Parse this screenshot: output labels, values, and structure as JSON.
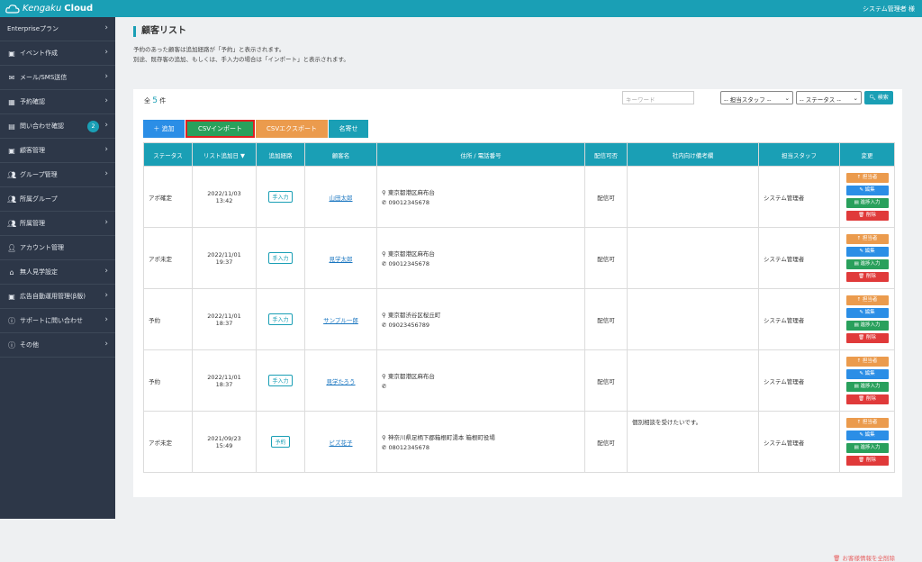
{
  "header": {
    "logo_prefix": "Kengaku",
    "logo_suffix": "Cloud",
    "user": "システム管理者 様"
  },
  "sidebar": {
    "items": [
      {
        "label": "Enterpriseプラン",
        "icon": "none",
        "chevron": true
      },
      {
        "label": "イベント作成",
        "icon": "image-icon",
        "chevron": true
      },
      {
        "label": "メール/SMS送信",
        "icon": "mail-icon",
        "chevron": true
      },
      {
        "label": "予約確認",
        "icon": "calendar-icon",
        "chevron": true
      },
      {
        "label": "問い合わせ確認",
        "icon": "inbox-icon",
        "chevron": true,
        "badge": "2"
      },
      {
        "label": "顧客管理",
        "icon": "id-card-icon",
        "chevron": true
      },
      {
        "label": "グループ管理",
        "icon": "users-icon",
        "chevron": true
      },
      {
        "label": "所属グループ",
        "icon": "users-icon",
        "chevron": false
      },
      {
        "label": "所属管理",
        "icon": "users-icon",
        "chevron": true
      },
      {
        "label": "アカウント管理",
        "icon": "user-gear-icon",
        "chevron": false
      },
      {
        "label": "無人見学設定",
        "icon": "home-icon",
        "chevron": true
      },
      {
        "label": "広告自動運用管理(β版)",
        "icon": "ad-icon",
        "chevron": true
      },
      {
        "label": "サポートに問い合わせ",
        "icon": "info-icon",
        "chevron": true
      },
      {
        "label": "その他",
        "icon": "info-icon",
        "chevron": true
      }
    ]
  },
  "page": {
    "title": "顧客リスト",
    "desc1": "予約のあった顧客は追加経路が「予約」と表示されます。",
    "desc2": "別途、既存客の追加、もしくは、手入力の場合は「インポート」と表示されます。",
    "count_prefix": "全",
    "count": "5",
    "count_suffix": "件",
    "keyword_placeholder": "キーワード",
    "staff_select": "-- 担当スタッフ --",
    "status_select": "-- ステータス --",
    "search_label": "検索",
    "add_label": "追加",
    "import_label": "CSVインポート",
    "export_label": "CSVエクスポート",
    "label_btn": "名寄せ",
    "delete_all": "お客様情報を全削除"
  },
  "table": {
    "headers": [
      "ステータス",
      "リスト追加日 ▼",
      "追加経路",
      "顧客名",
      "住所 / 電話番号",
      "配信可否",
      "社内向け備考欄",
      "担当スタッフ",
      "変更"
    ],
    "rows": [
      {
        "status": "アポ確定",
        "date": "2022/11/03",
        "time": "13:42",
        "route": "手入力",
        "name": "山田太郎",
        "address": "東京都港区麻布台",
        "phone": "09012345678",
        "delivery": "配信可",
        "memo": "",
        "staff": "システム管理者"
      },
      {
        "status": "アポ未定",
        "date": "2022/11/01",
        "time": "19:37",
        "route": "手入力",
        "name": "見学太郎",
        "address": "東京都港区麻布台",
        "phone": "09012345678",
        "delivery": "配信可",
        "memo": "",
        "staff": "システム管理者"
      },
      {
        "status": "予約",
        "date": "2022/11/01",
        "time": "18:37",
        "route": "手入力",
        "name": "サンプル一郎",
        "address": "東京都渋谷区桜丘町",
        "phone": "09023456789",
        "delivery": "配信可",
        "memo": "",
        "staff": "システム管理者"
      },
      {
        "status": "予約",
        "date": "2022/11/01",
        "time": "18:37",
        "route": "手入力",
        "name": "見学たろう",
        "address": "東京都港区麻布台",
        "phone": "",
        "delivery": "配信可",
        "memo": "",
        "staff": "システム管理者"
      },
      {
        "status": "アポ未定",
        "date": "2021/09/23",
        "time": "15:49",
        "route": "予約",
        "name": "ビズ花子",
        "address": "神奈川県足柄下郡箱根町湯本 箱根町役場",
        "phone": "08012345678",
        "delivery": "配信可",
        "memo": "個別相談を受けたいです。",
        "staff": "システム管理者"
      }
    ],
    "actions": {
      "assign": "担当者",
      "edit": "編集",
      "progress": "進捗入力",
      "delete": "削除"
    }
  },
  "colors": {
    "accent": "#1a9fb5",
    "sidebar": "#2d3748",
    "add": "#2b8ee6",
    "import": "#29a05c",
    "export": "#eb9b4d",
    "highlight": "#e02020"
  }
}
